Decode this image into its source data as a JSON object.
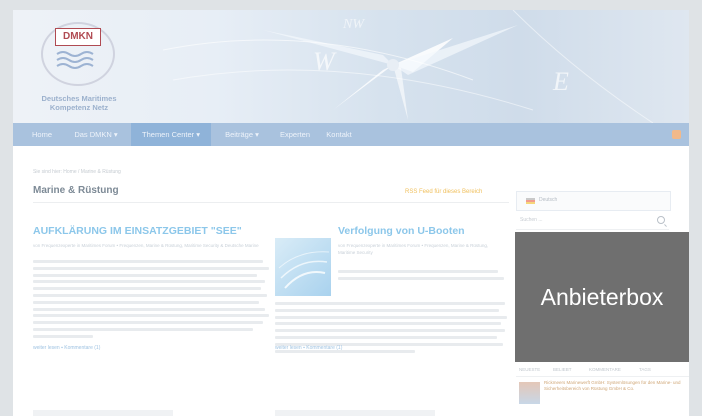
{
  "site": {
    "logo_text": "DMKN",
    "name_lines": [
      "Deutsches Maritimes",
      "Kompetenz Netz"
    ]
  },
  "nav": {
    "items": [
      {
        "label": "Home",
        "active": false
      },
      {
        "label": "Das DMKN ▾",
        "active": false
      },
      {
        "label": "Themen Center ▾",
        "active": true
      },
      {
        "label": "Beiträge ▾",
        "active": false
      },
      {
        "label": "Experten",
        "active": false
      },
      {
        "label": "Kontakt",
        "active": false
      }
    ]
  },
  "breadcrumb": "Sie sind hier: Home / Marine & Rüstung",
  "main": {
    "title": "Marine & Rüstung",
    "rss_link": "RSS Feed für dieses Bereich",
    "articles": [
      {
        "title": "AUFKLÄRUNG IM EINSATZGEBIET \"SEE\"",
        "meta": "von Frequenzexperte in Maritimes Forum • Frequenzen, Marine & Rüstung, Maritime Security & Deutsche Marine",
        "more": "weiter lesen  ▪  Kommentare (1)"
      },
      {
        "title": "Verfolgung von U-Booten",
        "meta": "von Frequenzexperte in Maritimes Forum • Frequenzen, Marine & Rüstung, Maritime Security",
        "more": "weiter lesen  ▪  Kommentare (1)"
      }
    ]
  },
  "sidebar": {
    "language": "Deutsch",
    "search_placeholder": "Suchen ...",
    "ad_box": "Anbieterbox",
    "tabs": [
      "NEUESTE",
      "BELIEBT",
      "KOMMENTARE",
      "TAGS"
    ],
    "recent_post": "Rickmeers Marinewerft GmbH: Systemlösungen für den Marine- und Sicherheitsbereich von Rüstung GmbH & Co."
  },
  "colors": {
    "nav_bg": "#a9c2de",
    "accent_title": "#8cc7ea",
    "ad_bg": "#6f6f6f",
    "rss": "#f0c05e"
  }
}
